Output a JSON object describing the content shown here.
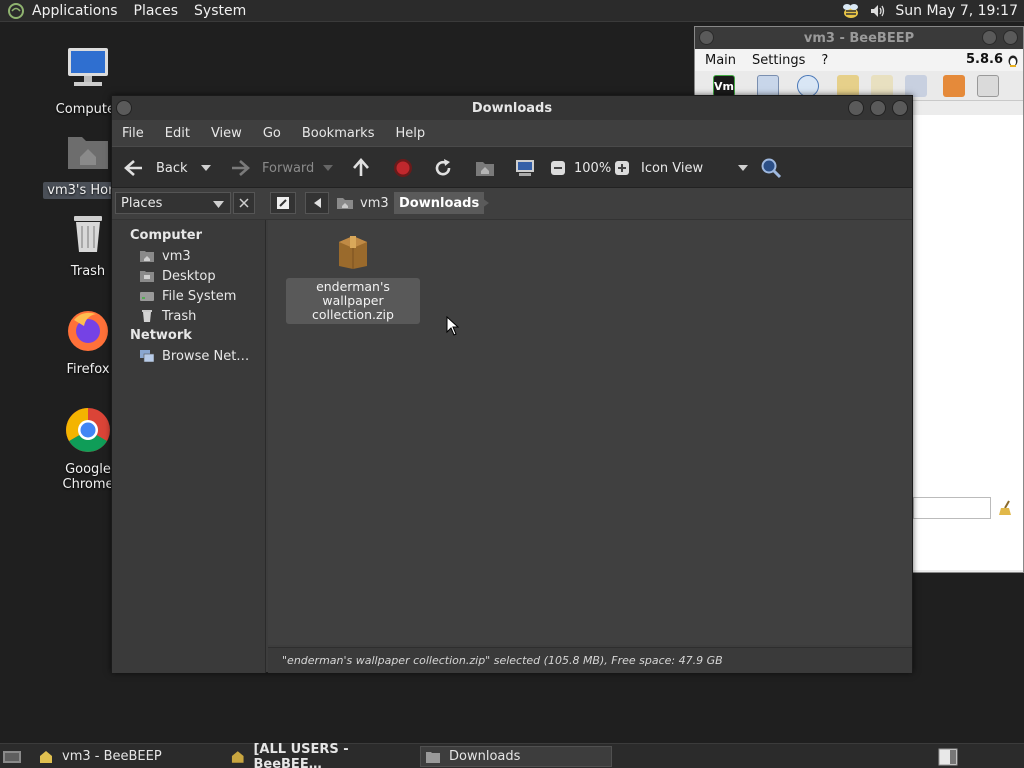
{
  "top_panel": {
    "menus": [
      "Applications",
      "Places",
      "System"
    ],
    "clock": "Sun May  7, 19:17"
  },
  "desktop": {
    "icons": [
      "Computer",
      "vm3's Home",
      "Trash",
      "Firefox",
      "Google Chrome"
    ]
  },
  "beebeep": {
    "title": "vm3 - BeeBEEP",
    "menus": [
      "Main",
      "Settings",
      "?"
    ],
    "version": "5.8.6",
    "toolbar_vm": "Vm"
  },
  "file_manager": {
    "title": "Downloads",
    "menus": [
      "File",
      "Edit",
      "View",
      "Go",
      "Bookmarks",
      "Help"
    ],
    "toolbar": {
      "back": "Back",
      "forward": "Forward",
      "zoom": "100%",
      "view_mode": "Icon View"
    },
    "location": {
      "places_label": "Places",
      "crumbs": [
        "vm3",
        "Downloads"
      ]
    },
    "sidebar": {
      "computer_header": "Computer",
      "computer_items": [
        "vm3",
        "Desktop",
        "File System",
        "Trash"
      ],
      "network_header": "Network",
      "network_items": [
        "Browse Net…"
      ]
    },
    "files": [
      {
        "line1": "enderman's wallpaper",
        "line2": "collection.zip"
      }
    ],
    "status": "\"enderman's wallpaper collection.zip\" selected (105.8 MB), Free space: 47.9 GB"
  },
  "taskbar": {
    "items": [
      "vm3 - BeeBEEP",
      "[ALL USERS - BeeBEE…",
      "Downloads"
    ]
  },
  "colors": {
    "desktop_bg": "#1f1f1f",
    "window_bg": "#3d3d3d",
    "stop_red": "#c0282d"
  }
}
